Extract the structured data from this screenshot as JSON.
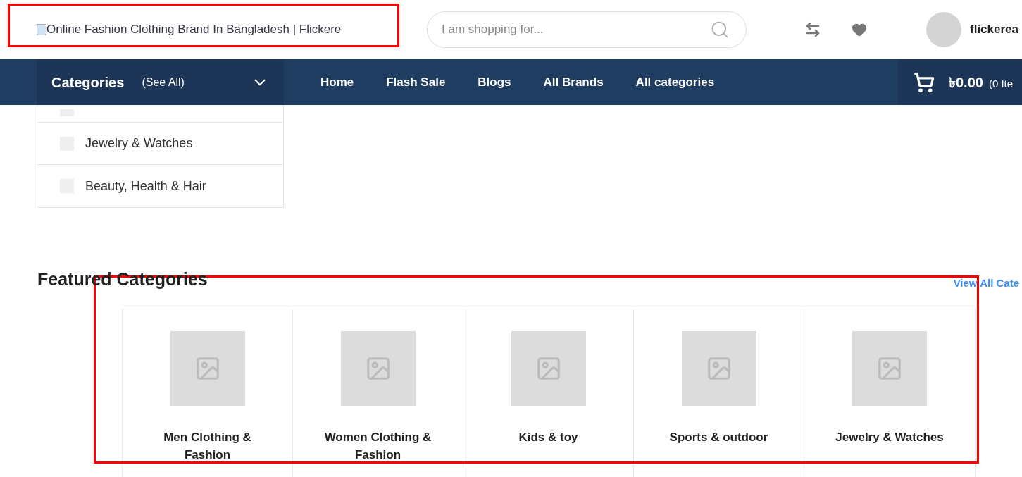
{
  "header": {
    "logo_alt": "Online Fashion Clothing Brand In Bangladesh | Flickere",
    "search": {
      "placeholder": "I am shopping for..."
    },
    "user": "flickerea"
  },
  "nav": {
    "categories_title": "Categories",
    "see_all": "(See All)",
    "links": [
      "Home",
      "Flash Sale",
      "Blogs",
      "All Brands",
      "All categories"
    ],
    "cart_total": "৳0.00",
    "cart_items": "(0 Ite"
  },
  "category_menu": [
    "Jewelry & Watches",
    "Beauty, Health & Hair"
  ],
  "featured": {
    "title": "Featured Categories",
    "view_all": "View All Cate",
    "items": [
      "Men Clothing & Fashion",
      "Women Clothing & Fashion",
      "Kids & toy",
      "Sports & outdoor",
      "Jewelry & Watches"
    ]
  }
}
